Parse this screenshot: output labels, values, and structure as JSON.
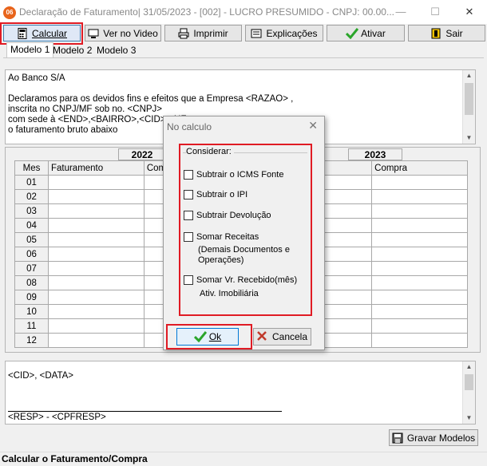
{
  "window": {
    "app_icon_text": "06",
    "title": "Declaração de Faturamento|  31/05/2023 - [002] - LUCRO PRESUMIDO - CNPJ: 00.00...",
    "minimize": "—",
    "maximize": "☐",
    "close": "✕"
  },
  "toolbar": {
    "calcular": "Calcular",
    "ver_video": "Ver no Video",
    "imprimir": "Imprimir",
    "explicacoes": "Explicações",
    "ativar": "Ativar",
    "sair": "Sair"
  },
  "tabs": [
    "Modelo 1",
    "Modelo 2",
    "Modelo 3"
  ],
  "letter_text": "Ao Banco S/A\n\nDeclaramos para os devidos fins e efeitos que a Empresa <RAZAO> ,\ninscrita no CNPJ/MF sob no. <CNPJ>\ncom sede à <END>,<BAIRRO>,<CID>-<UF> ...\no faturamento bruto abaixo",
  "grid": {
    "year_left": "2022",
    "year_right": "2023",
    "headers": {
      "mes": "Mes",
      "faturamento": "Faturamento",
      "compra_left": "Com",
      "compra_right": "Compra"
    },
    "months": [
      "01",
      "02",
      "03",
      "04",
      "05",
      "06",
      "07",
      "08",
      "09",
      "10",
      "11",
      "12"
    ]
  },
  "footer_text": "<CID>, <DATA>",
  "signature_text": "<RESP> - <CPFRESP>",
  "gravar_modelos": "Gravar Modelos",
  "status": "Calcular o Faturamento/Compra",
  "dialog": {
    "title": "No calculo",
    "group_title": "Considerar:",
    "options": [
      {
        "label": "Subtrair o ICMS Fonte",
        "checked": false
      },
      {
        "label": "Subtrair o IPI",
        "checked": false
      },
      {
        "label": "Subtrair Devolução",
        "checked": false
      },
      {
        "label": "Somar Receitas",
        "sub1": "(Demais Documentos e",
        "sub2": "Operações)",
        "checked": false
      },
      {
        "label": "Somar Vr. Recebido(mês)",
        "sub1": "Ativ. Imobiliária",
        "checked": false
      }
    ],
    "ok": "Ok",
    "cancel": "Cancela"
  },
  "colors": {
    "highlight": "#e01b24",
    "ok_check": "#2aa52a"
  }
}
